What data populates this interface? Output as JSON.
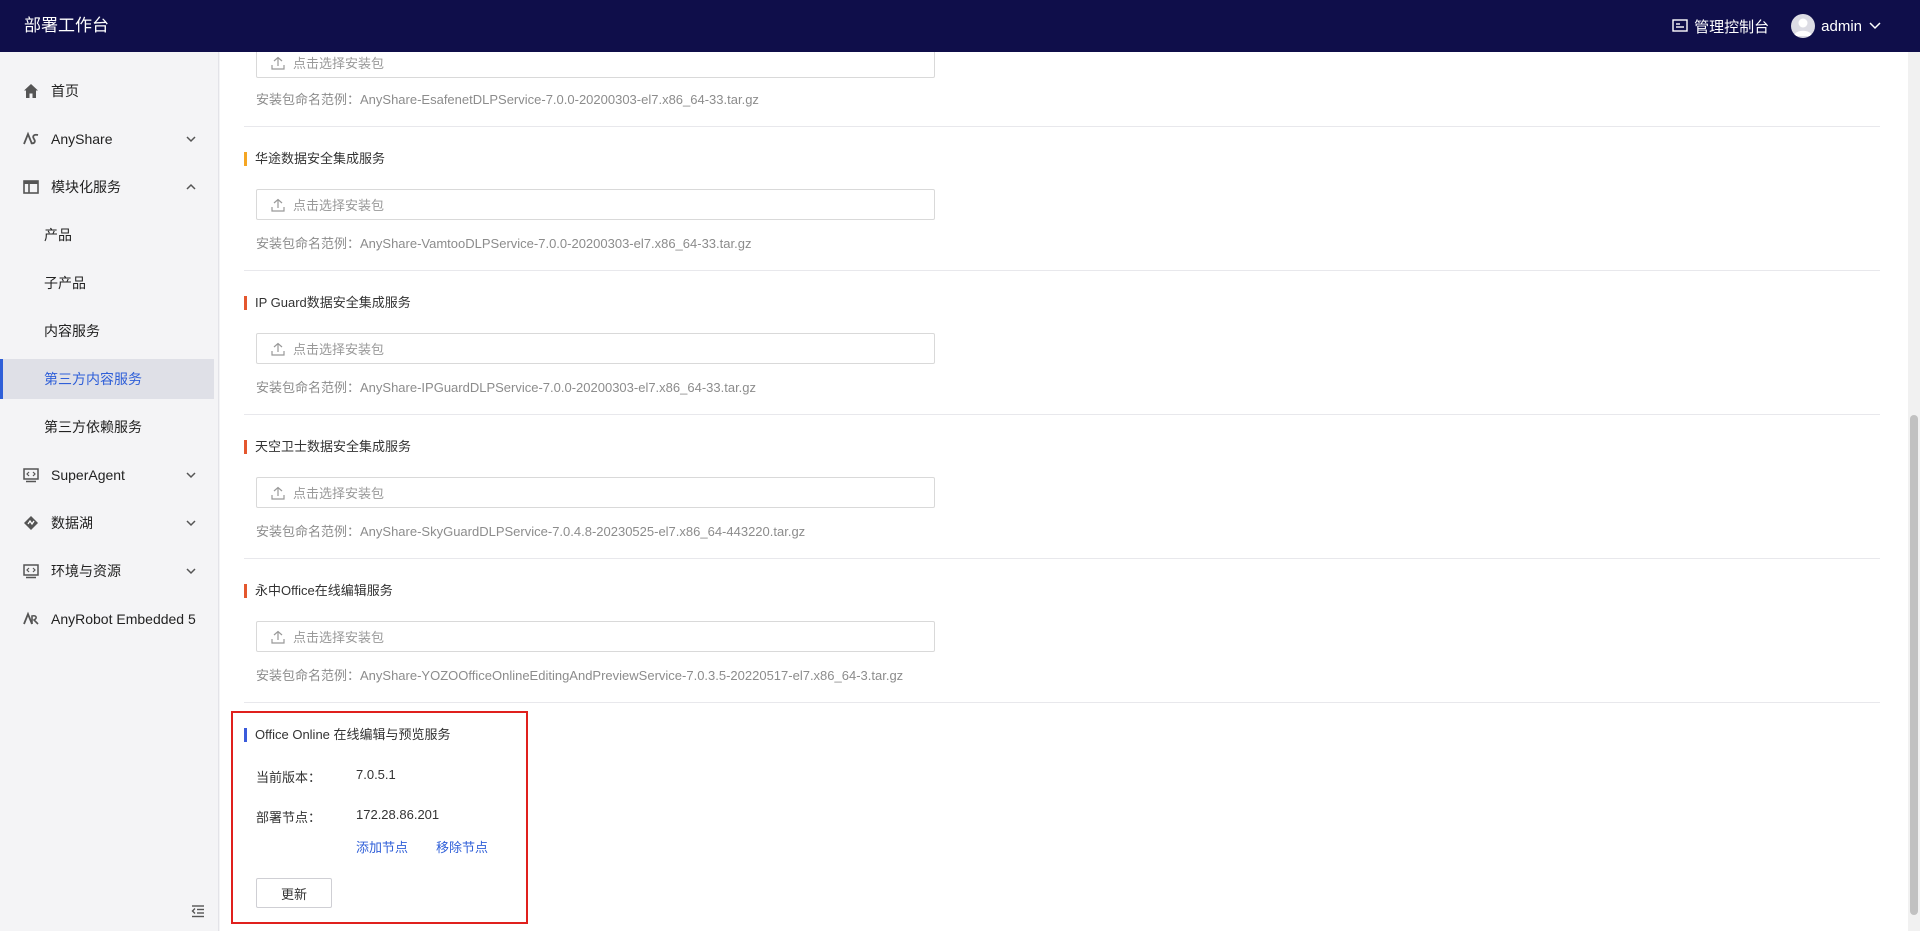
{
  "header": {
    "app_title": "部署工作台",
    "console_label": "管理控制台",
    "user_name": "admin"
  },
  "sidebar": {
    "items": [
      {
        "label": "首页",
        "icon": "home-icon"
      },
      {
        "label": "AnyShare",
        "icon": "anyshare-icon"
      },
      {
        "label": "模块化服务",
        "icon": "module-icon"
      },
      {
        "label": "SuperAgent",
        "icon": "code-icon"
      },
      {
        "label": "数据湖",
        "icon": "datalake-icon"
      },
      {
        "label": "环境与资源",
        "icon": "code-icon"
      },
      {
        "label": "AnyRobot Embedded 5",
        "icon": "anyrobot-icon"
      }
    ],
    "sub_items": [
      {
        "label": "产品"
      },
      {
        "label": "子产品"
      },
      {
        "label": "内容服务"
      },
      {
        "label": "第三方内容服务",
        "active": true
      },
      {
        "label": "第三方依赖服务"
      }
    ]
  },
  "main": {
    "upload_placeholder": "点击选择安装包",
    "sections": [
      {
        "title": "",
        "hint": "安装包命名范例：AnyShare-EsafenetDLPService-7.0.0-20200303-el7.x86_64-33.tar.gz"
      },
      {
        "title": "华途数据安全集成服务",
        "hint": "安装包命名范例：AnyShare-VamtooDLPService-7.0.0-20200303-el7.x86_64-33.tar.gz"
      },
      {
        "title": "IP Guard数据安全集成服务",
        "hint": "安装包命名范例：AnyShare-IPGuardDLPService-7.0.0-20200303-el7.x86_64-33.tar.gz"
      },
      {
        "title": "天空卫士数据安全集成服务",
        "hint": "安装包命名范例：AnyShare-SkyGuardDLPService-7.0.4.8-20230525-el7.x86_64-443220.tar.gz"
      },
      {
        "title": "永中Office在线编辑服务",
        "hint": "安装包命名范例：AnyShare-YOZOOfficeOnlineEditingAndPreviewService-7.0.3.5-20220517-el7.x86_64-3.tar.gz"
      }
    ],
    "office_online": {
      "title": "Office Online 在线编辑与预览服务",
      "version_label": "当前版本：",
      "version_value": "7.0.5.1",
      "node_label": "部署节点：",
      "node_value": "172.28.86.201",
      "add_node": "添加节点",
      "remove_node": "移除节点",
      "update_button": "更新"
    }
  },
  "colors": {
    "header_bg": "#0f0e4a",
    "accent": "#2f5fd8",
    "highlight_border": "#e0201d"
  }
}
